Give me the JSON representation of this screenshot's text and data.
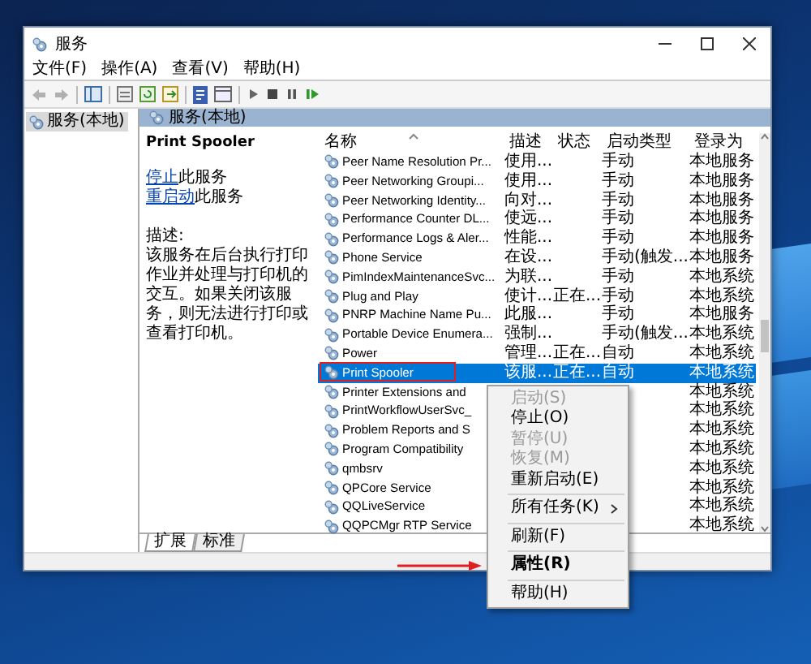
{
  "window": {
    "title": "服务"
  },
  "menu_bar": [
    "文件(F)",
    "操作(A)",
    "查看(V)",
    "帮助(H)"
  ],
  "tree": [
    {
      "label": "服务(本地)",
      "selected": true
    }
  ],
  "panel_header": "服务(本地)",
  "details": {
    "title": "Print Spooler",
    "actions": [
      {
        "link": "停止",
        "text": "此服务"
      },
      {
        "link": "重启动",
        "text": "此服务"
      }
    ],
    "description_label": "描述:",
    "description": "该服务在后台执行打印作业并处理与打印机的交互。如果关闭该服务，则无法进行打印或查看打印机。"
  },
  "table": {
    "columns": [
      "名称",
      "描述",
      "状态",
      "启动类型",
      "登录为"
    ],
    "rows": [
      {
        "name": "Peer Name Resolution Pr...",
        "description": "使用...",
        "status": "",
        "startup": "手动",
        "logon": "本地服务",
        "selected": false,
        "annotated": false
      },
      {
        "name": "Peer Networking Groupi...",
        "description": "使用...",
        "status": "",
        "startup": "手动",
        "logon": "本地服务",
        "selected": false,
        "annotated": false
      },
      {
        "name": "Peer Networking Identity...",
        "description": "向对...",
        "status": "",
        "startup": "手动",
        "logon": "本地服务",
        "selected": false,
        "annotated": false
      },
      {
        "name": "Performance Counter DL...",
        "description": "使远...",
        "status": "",
        "startup": "手动",
        "logon": "本地服务",
        "selected": false,
        "annotated": false
      },
      {
        "name": "Performance Logs & Aler...",
        "description": "性能...",
        "status": "",
        "startup": "手动",
        "logon": "本地服务",
        "selected": false,
        "annotated": false
      },
      {
        "name": "Phone Service",
        "description": "在设...",
        "status": "",
        "startup": "手动(触发...",
        "logon": "本地服务",
        "selected": false,
        "annotated": false
      },
      {
        "name": "PimIndexMaintenanceSvc...",
        "description": "为联...",
        "status": "",
        "startup": "手动",
        "logon": "本地系统",
        "selected": false,
        "annotated": false
      },
      {
        "name": "Plug and Play",
        "description": "使计...",
        "status": "正在...",
        "startup": "手动",
        "logon": "本地系统",
        "selected": false,
        "annotated": false
      },
      {
        "name": "PNRP Machine Name Pu...",
        "description": "此服...",
        "status": "",
        "startup": "手动",
        "logon": "本地服务",
        "selected": false,
        "annotated": false
      },
      {
        "name": "Portable Device Enumera...",
        "description": "强制...",
        "status": "",
        "startup": "手动(触发...",
        "logon": "本地系统",
        "selected": false,
        "annotated": false
      },
      {
        "name": "Power",
        "description": "管理...",
        "status": "正在...",
        "startup": "自动",
        "logon": "本地系统",
        "selected": false,
        "annotated": false
      },
      {
        "name": "Print Spooler",
        "description": "该服...",
        "status": "正在...",
        "startup": "自动",
        "logon": "本地系统",
        "selected": true,
        "annotated": true
      },
      {
        "name": "Printer Extensions and",
        "description": "",
        "status": "",
        "startup": "",
        "logon": "本地系统",
        "selected": false,
        "annotated": false
      },
      {
        "name": "PrintWorkflowUserSvc_",
        "description": "",
        "status": "",
        "startup": "",
        "logon": "本地系统",
        "selected": false,
        "annotated": false
      },
      {
        "name": "Problem Reports and S",
        "description": "",
        "status": "",
        "startup": "",
        "logon": "本地系统",
        "selected": false,
        "annotated": false
      },
      {
        "name": "Program Compatibility",
        "description": "",
        "status": "",
        "startup": "",
        "logon": "本地系统",
        "selected": false,
        "annotated": false
      },
      {
        "name": "qmbsrv",
        "description": "",
        "status": "",
        "startup": "",
        "logon": "本地系统",
        "selected": false,
        "annotated": false
      },
      {
        "name": "QPCore Service",
        "description": "",
        "status": "",
        "startup": "",
        "logon": "本地系统",
        "selected": false,
        "annotated": false
      },
      {
        "name": "QQLiveService",
        "description": "",
        "status": "",
        "startup": "",
        "logon": "本地系统",
        "selected": false,
        "annotated": false
      },
      {
        "name": "QQPCMgr RTP Service",
        "description": "",
        "status": "",
        "startup": "",
        "logon": "本地系统",
        "selected": false,
        "annotated": false
      }
    ]
  },
  "tabs": [
    {
      "label": "扩展",
      "selected": true
    },
    {
      "label": "标准",
      "selected": false
    }
  ],
  "context_menu": [
    {
      "kind": "item",
      "label": "启动(S)",
      "disabled": true,
      "default": false,
      "submenu": false,
      "annotated": false
    },
    {
      "kind": "item",
      "label": "停止(O)",
      "disabled": false,
      "default": false,
      "submenu": false,
      "annotated": false
    },
    {
      "kind": "item",
      "label": "暂停(U)",
      "disabled": true,
      "default": false,
      "submenu": false,
      "annotated": false
    },
    {
      "kind": "item",
      "label": "恢复(M)",
      "disabled": true,
      "default": false,
      "submenu": false,
      "annotated": false
    },
    {
      "kind": "item",
      "label": "重新启动(E)",
      "disabled": false,
      "default": false,
      "submenu": false,
      "annotated": false
    },
    {
      "kind": "separator"
    },
    {
      "kind": "item",
      "label": "所有任务(K)",
      "disabled": false,
      "default": false,
      "submenu": true,
      "annotated": false
    },
    {
      "kind": "separator"
    },
    {
      "kind": "item",
      "label": "刷新(F)",
      "disabled": false,
      "default": false,
      "submenu": false,
      "annotated": false
    },
    {
      "kind": "separator"
    },
    {
      "kind": "item",
      "label": "属性(R)",
      "disabled": false,
      "default": true,
      "submenu": false,
      "annotated": true
    },
    {
      "kind": "separator"
    },
    {
      "kind": "item",
      "label": "帮助(H)",
      "disabled": false,
      "default": false,
      "submenu": false,
      "annotated": false
    }
  ]
}
